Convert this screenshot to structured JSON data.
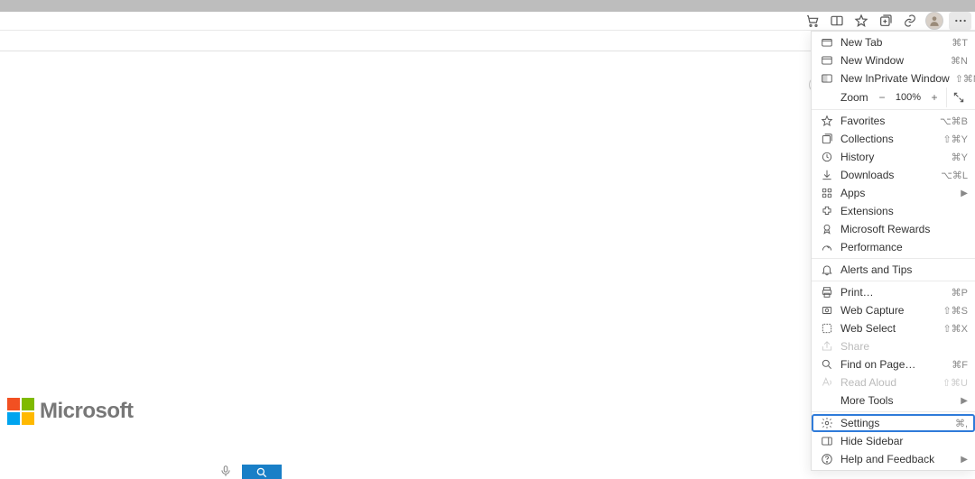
{
  "toolbar": {
    "shopping_icon": "shopping-cart-icon",
    "split_icon": "split-screen-icon",
    "favorites_icon": "star-icon",
    "collections_icon": "collections-icon",
    "share_icon": "link-icon",
    "avatar_icon": "person-icon",
    "more_icon": "more-horizontal-icon"
  },
  "page": {
    "logo_text": "Microsoft"
  },
  "menu": {
    "zoom_label": "Zoom",
    "zoom_value": "100%",
    "groups": [
      {
        "items": [
          {
            "icon": "tab-icon",
            "label": "New Tab",
            "shortcut": "⌘T",
            "submenu": false
          },
          {
            "icon": "window-icon",
            "label": "New Window",
            "shortcut": "⌘N",
            "submenu": false
          },
          {
            "icon": "inprivate-icon",
            "label": "New InPrivate Window",
            "shortcut": "⇧⌘N",
            "submenu": false
          }
        ]
      },
      {
        "items": [
          {
            "icon": "star-icon",
            "label": "Favorites",
            "shortcut": "⌥⌘B",
            "submenu": false
          },
          {
            "icon": "collections-icon",
            "label": "Collections",
            "shortcut": "⇧⌘Y",
            "submenu": false
          },
          {
            "icon": "history-icon",
            "label": "History",
            "shortcut": "⌘Y",
            "submenu": false
          },
          {
            "icon": "download-icon",
            "label": "Downloads",
            "shortcut": "⌥⌘L",
            "submenu": false
          },
          {
            "icon": "apps-icon",
            "label": "Apps",
            "shortcut": "",
            "submenu": true
          },
          {
            "icon": "extensions-icon",
            "label": "Extensions",
            "shortcut": "",
            "submenu": false
          },
          {
            "icon": "rewards-icon",
            "label": "Microsoft Rewards",
            "shortcut": "",
            "submenu": false
          },
          {
            "icon": "performance-icon",
            "label": "Performance",
            "shortcut": "",
            "submenu": false
          }
        ]
      },
      {
        "items": [
          {
            "icon": "bell-icon",
            "label": "Alerts and Tips",
            "shortcut": "",
            "submenu": false
          }
        ]
      },
      {
        "items": [
          {
            "icon": "print-icon",
            "label": "Print…",
            "shortcut": "⌘P",
            "submenu": false
          },
          {
            "icon": "capture-icon",
            "label": "Web Capture",
            "shortcut": "⇧⌘S",
            "submenu": false
          },
          {
            "icon": "select-icon",
            "label": "Web Select",
            "shortcut": "⇧⌘X",
            "submenu": false
          },
          {
            "icon": "share-icon",
            "label": "Share",
            "shortcut": "",
            "submenu": false,
            "disabled": true
          },
          {
            "icon": "find-icon",
            "label": "Find on Page…",
            "shortcut": "⌘F",
            "submenu": false
          },
          {
            "icon": "read-aloud-icon",
            "label": "Read Aloud",
            "shortcut": "⇧⌘U",
            "submenu": false,
            "disabled": true
          },
          {
            "icon": "",
            "label": "More Tools",
            "shortcut": "",
            "submenu": true
          }
        ]
      },
      {
        "items": [
          {
            "icon": "settings-icon",
            "label": "Settings",
            "shortcut": "⌘,",
            "submenu": false,
            "highlight": true
          },
          {
            "icon": "sidebar-icon",
            "label": "Hide Sidebar",
            "shortcut": "",
            "submenu": false
          },
          {
            "icon": "help-icon",
            "label": "Help and Feedback",
            "shortcut": "",
            "submenu": true
          }
        ]
      }
    ]
  }
}
